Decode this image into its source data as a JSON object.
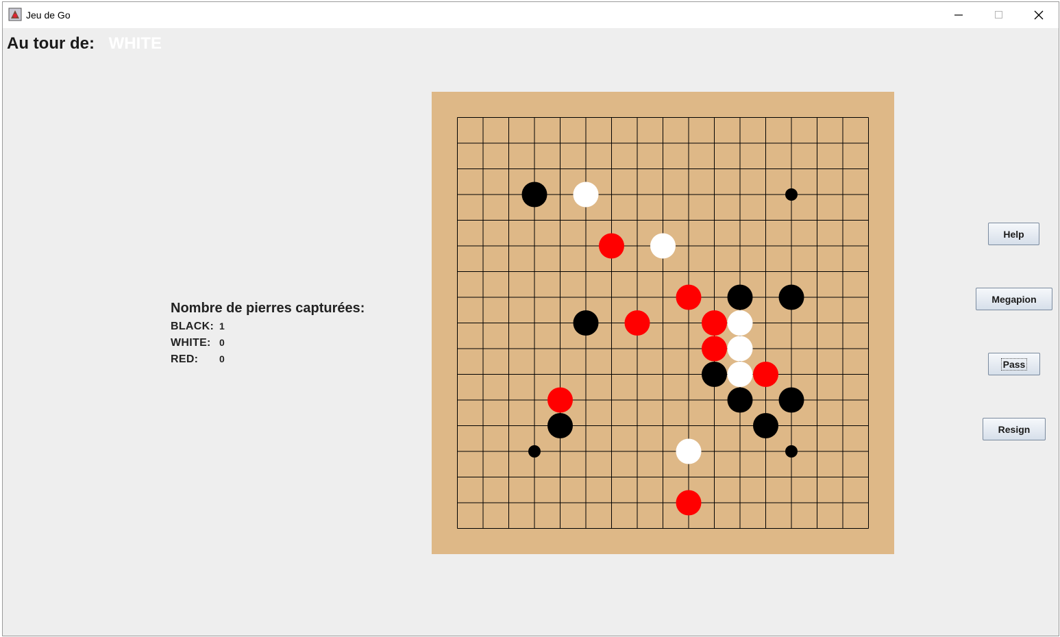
{
  "window": {
    "title": "Jeu de Go",
    "icon": "java-app-icon"
  },
  "turn": {
    "label": "Au tour de:",
    "player": "WHITE"
  },
  "captures": {
    "title": "Nombre de pierres capturées:",
    "rows": [
      {
        "name": "BLACK:",
        "value": "1"
      },
      {
        "name": "WHITE:",
        "value": "0"
      },
      {
        "name": "RED:",
        "value": "0"
      }
    ]
  },
  "board": {
    "size": 17,
    "colors": {
      "wood": "#deb887",
      "line": "#000000"
    },
    "hoshi": [
      [
        13,
        3
      ],
      [
        3,
        13
      ],
      [
        13,
        13
      ]
    ],
    "stones": [
      {
        "c": 3,
        "r": 3,
        "color": "black"
      },
      {
        "c": 5,
        "r": 3,
        "color": "white"
      },
      {
        "c": 6,
        "r": 5,
        "color": "red"
      },
      {
        "c": 8,
        "r": 5,
        "color": "white"
      },
      {
        "c": 9,
        "r": 7,
        "color": "red"
      },
      {
        "c": 11,
        "r": 7,
        "color": "black"
      },
      {
        "c": 13,
        "r": 7,
        "color": "black"
      },
      {
        "c": 5,
        "r": 8,
        "color": "black"
      },
      {
        "c": 7,
        "r": 8,
        "color": "red"
      },
      {
        "c": 10,
        "r": 8,
        "color": "red"
      },
      {
        "c": 11,
        "r": 8,
        "color": "white"
      },
      {
        "c": 10,
        "r": 9,
        "color": "red"
      },
      {
        "c": 11,
        "r": 9,
        "color": "white"
      },
      {
        "c": 10,
        "r": 10,
        "color": "black"
      },
      {
        "c": 11,
        "r": 10,
        "color": "white"
      },
      {
        "c": 12,
        "r": 10,
        "color": "red"
      },
      {
        "c": 4,
        "r": 11,
        "color": "red"
      },
      {
        "c": 11,
        "r": 11,
        "color": "black"
      },
      {
        "c": 13,
        "r": 11,
        "color": "black"
      },
      {
        "c": 4,
        "r": 12,
        "color": "black"
      },
      {
        "c": 12,
        "r": 12,
        "color": "black"
      },
      {
        "c": 9,
        "r": 13,
        "color": "white"
      },
      {
        "c": 9,
        "r": 15,
        "color": "red"
      }
    ]
  },
  "buttons": {
    "help": "Help",
    "megapion": "Megapion",
    "pass": "Pass",
    "resign": "Resign"
  }
}
